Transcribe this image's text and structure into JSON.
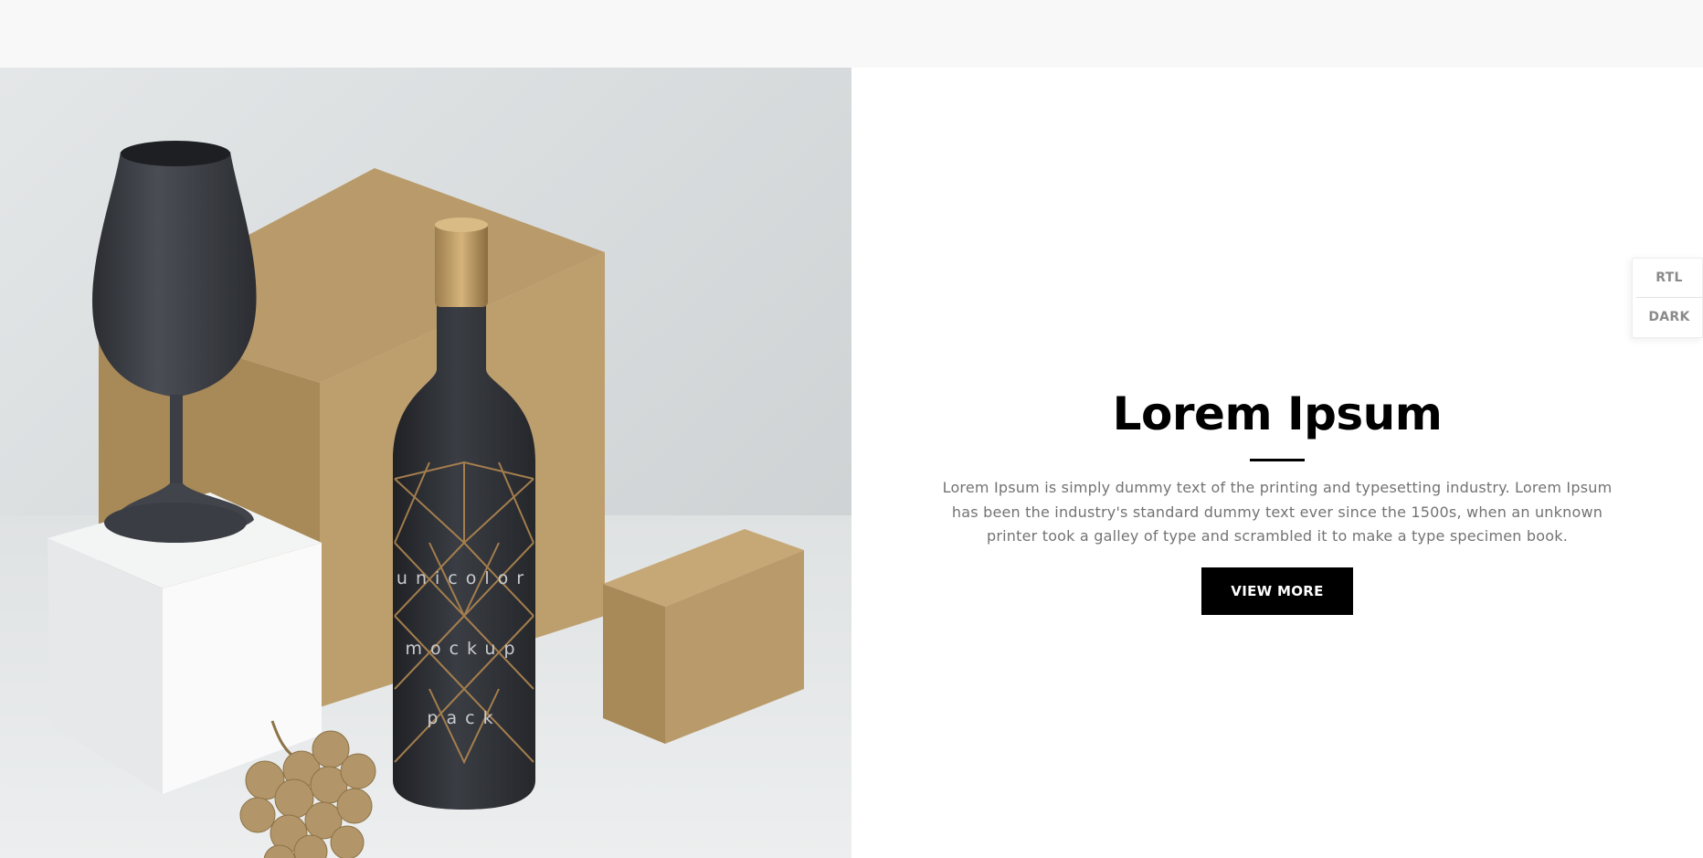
{
  "hero": {
    "bottle_label_lines": [
      "unicolor",
      "mockup",
      "pack"
    ]
  },
  "content": {
    "title": "Lorem Ipsum",
    "description": "Lorem Ipsum is simply dummy text of the printing and typesetting industry. Lorem Ipsum has been the industry's standard dummy text ever since the 1500s, when an unknown printer took a galley of type and scrambled it to make a type specimen book.",
    "button_label": "VIEW MORE"
  },
  "side_panel": {
    "rtl_label": "RTL",
    "dark_label": "DARK"
  },
  "colors": {
    "topbar": "#f8f8f8",
    "text_dark": "#000000",
    "text_muted": "#737373",
    "button_bg": "#000000",
    "button_text": "#ffffff",
    "kraft": "#b89a67",
    "bottle": "#2e3035"
  }
}
